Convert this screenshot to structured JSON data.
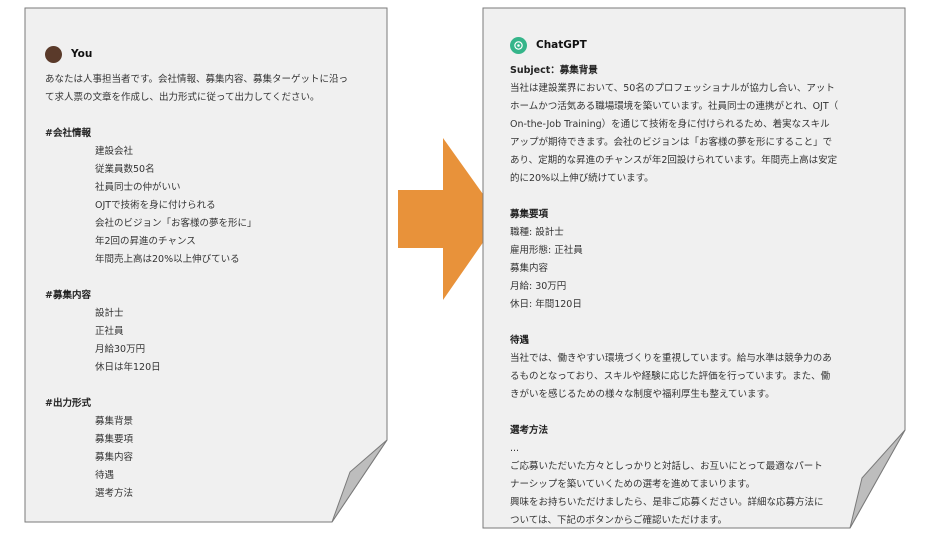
{
  "left_doc": {
    "speaker": "You",
    "intro": [
      "あなたは人事担当者です。会社情報、募集内容、募集ターゲットに沿っ",
      "て求人票の文章を作成し、出力形式に従って出力してください。"
    ],
    "sections": [
      {
        "heading": "#会社情報",
        "items": [
          "建設会社",
          "従業員数50名",
          "社員同士の仲がいい",
          "OJTで技術を身に付けられる",
          "会社のビジョン「お客様の夢を形に」",
          "年2回の昇進のチャンス",
          "年間売上高は20%以上伸びている"
        ]
      },
      {
        "heading": "#募集内容",
        "items": [
          "設計士",
          "正社員",
          "月給30万円",
          "休日は年120日"
        ]
      },
      {
        "heading": "#出力形式",
        "items": [
          "募集背景",
          "募集要項",
          "募集内容",
          "待遇",
          "選考方法"
        ]
      }
    ]
  },
  "right_doc": {
    "speaker": "ChatGPT",
    "subject": "Subject：募集背景",
    "background": [
      "当社は建設業界において、50名のプロフェッショナルが協力し合い、アット",
      "ホームかつ活気ある職場環境を築いています。社員同士の連携がとれ、OJT（",
      "On-the-Job Training）を通じて技術を身に付けられるため、着実なスキル",
      "アップが期待できます。会社のビジョンは「お客様の夢を形にすること」で",
      "あり、定期的な昇進のチャンスが年2回設けられています。年間売上高は安定",
      "的に20%以上伸び続けています。"
    ],
    "requirements_heading": "募集要項",
    "requirements": [
      "職種: 設計士",
      "雇用形態: 正社員",
      "募集内容",
      "月給: 30万円",
      "休日: 年間120日"
    ],
    "treatment_heading": "待遇",
    "treatment": [
      "当社では、働きやすい環境づくりを重視しています。給与水準は競争力のあ",
      "るものとなっており、スキルや経験に応じた評価を行っています。また、働",
      "きがいを感じるための様々な制度や福利厚生も整えています。"
    ],
    "selection_heading": "選考方法",
    "selection": [
      "...",
      "ご応募いただいた方々としっかりと対話し、お互いにとって最適なパート",
      "ナーシップを築いていくための選考を進めてまいります。",
      "興味をお持ちいただけましたら、是非ご応募ください。詳細な応募方法に",
      "ついては、下記のボタンからご確認いただけます。"
    ]
  },
  "colors": {
    "paper": "#f0f0f0",
    "paper_border": "#7a7a7a",
    "fold": "#bdbdbd",
    "arrow": "#e8923a",
    "user_avatar": "#5a3a2a",
    "gpt_avatar": "#35b58a"
  },
  "icons": {
    "left_avatar": "user-avatar",
    "right_avatar": "chatgpt-logo-icon",
    "arrow": "right-arrow-icon"
  }
}
